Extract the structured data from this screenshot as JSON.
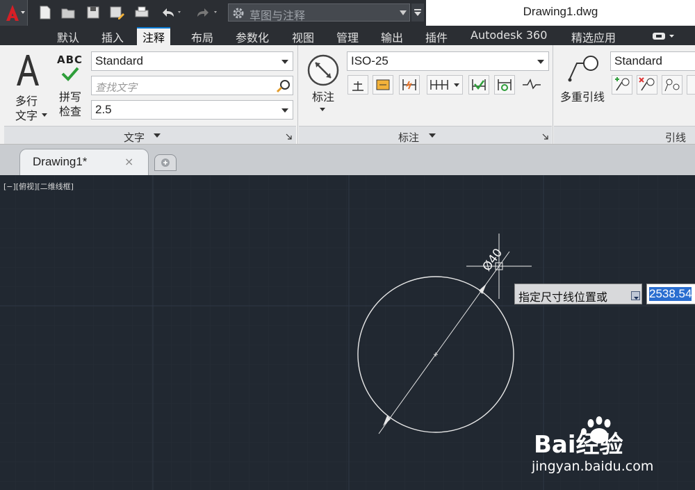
{
  "titlebar": {
    "workspace": "草图与注释",
    "document_title": "Drawing1.dwg"
  },
  "ribbon_tabs": [
    "默认",
    "插入",
    "注释",
    "布局",
    "参数化",
    "视图",
    "管理",
    "输出",
    "插件",
    "Autodesk 360",
    "精选应用"
  ],
  "active_tab": "注释",
  "text_panel": {
    "title": "文字",
    "multiline_text_l1": "多行",
    "multiline_text_l2": "文字",
    "spell_icon_text": "ABC",
    "spell_check_l1": "拼写",
    "spell_check_l2": "检查",
    "style_value": "Standard",
    "find_placeholder": "查找文字",
    "height_value": "2.5"
  },
  "dim_panel": {
    "title": "标注",
    "dimension_label": "标注",
    "style_value": "ISO-25"
  },
  "leader_panel": {
    "title": "引线",
    "multileader_label": "多重引线",
    "style_value": "Standard"
  },
  "file_tab": {
    "label": "Drawing1*",
    "close": "×"
  },
  "viewport": {
    "label": "[−][俯视][二维线框]",
    "dimension_text": "Ø40",
    "prompt": "指定尺寸线位置或",
    "input_value": "2538.54"
  },
  "watermark": {
    "text": "Bai经验",
    "url": "jingyan.baidu.com"
  },
  "colors": {
    "canvas_bg": "#212831",
    "ribbon_bg": "#f1f1f1",
    "titlebar_bg": "#2b2e33",
    "accent": "#0b7ad1",
    "selection": "#2a6ed0"
  }
}
